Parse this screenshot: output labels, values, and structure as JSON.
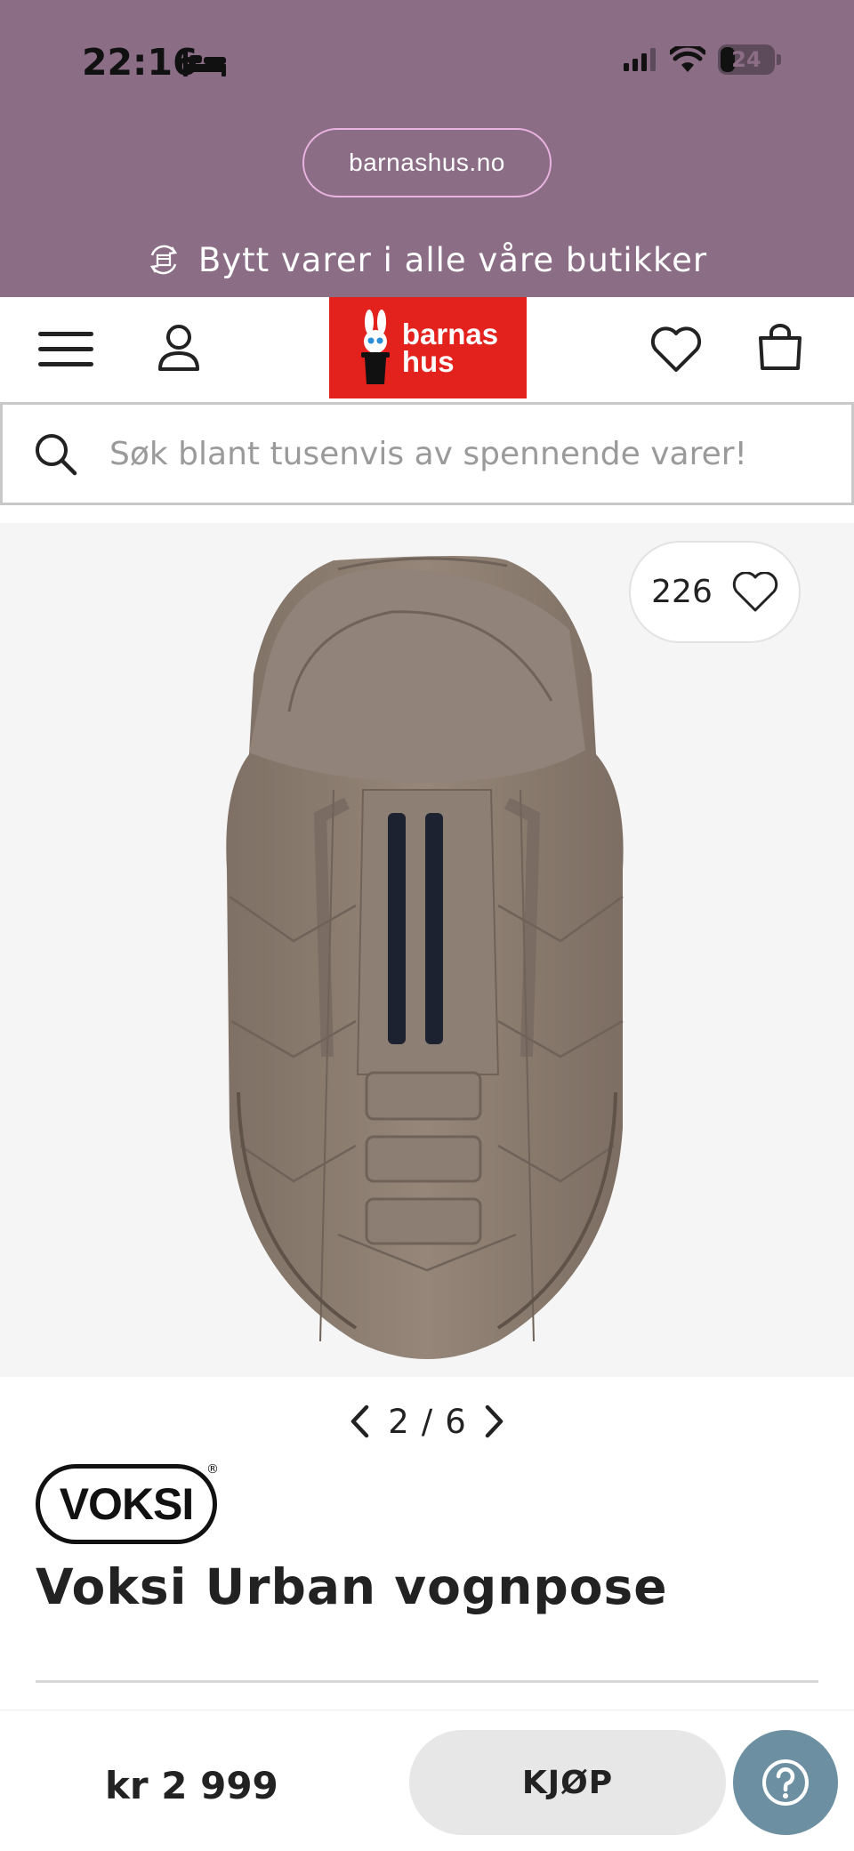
{
  "status_bar": {
    "time": "22:16",
    "battery": "24",
    "icons": [
      "bed-icon",
      "signal-icon",
      "wifi-icon",
      "battery-icon"
    ]
  },
  "browser": {
    "url": "barnashus.no"
  },
  "promo": {
    "text": "Bytt varer i alle våre butikker",
    "icon": "exchange-icon"
  },
  "header": {
    "logo_line1": "barnas",
    "logo_line2": "hus",
    "icons": [
      "menu-icon",
      "user-icon",
      "heart-icon",
      "bag-icon"
    ],
    "brand_color": "#e3221d"
  },
  "search": {
    "placeholder": "Søk blant tusenvis av spennende varer!"
  },
  "gallery": {
    "like_count": "226",
    "current_page": "2",
    "separator": "/",
    "total_pages": "6"
  },
  "product": {
    "brand": "VOKSI",
    "brand_mark": "®",
    "title": "Voksi Urban vognpose",
    "price": "kr 2 999"
  },
  "actions": {
    "buy_label": "KJØP",
    "help_icon": "question-icon"
  },
  "colors": {
    "top_band": "#8c6d86",
    "url_border": "#e8b3df",
    "help_button": "#6c8fa1",
    "buy_button": "#e7e7e7"
  }
}
